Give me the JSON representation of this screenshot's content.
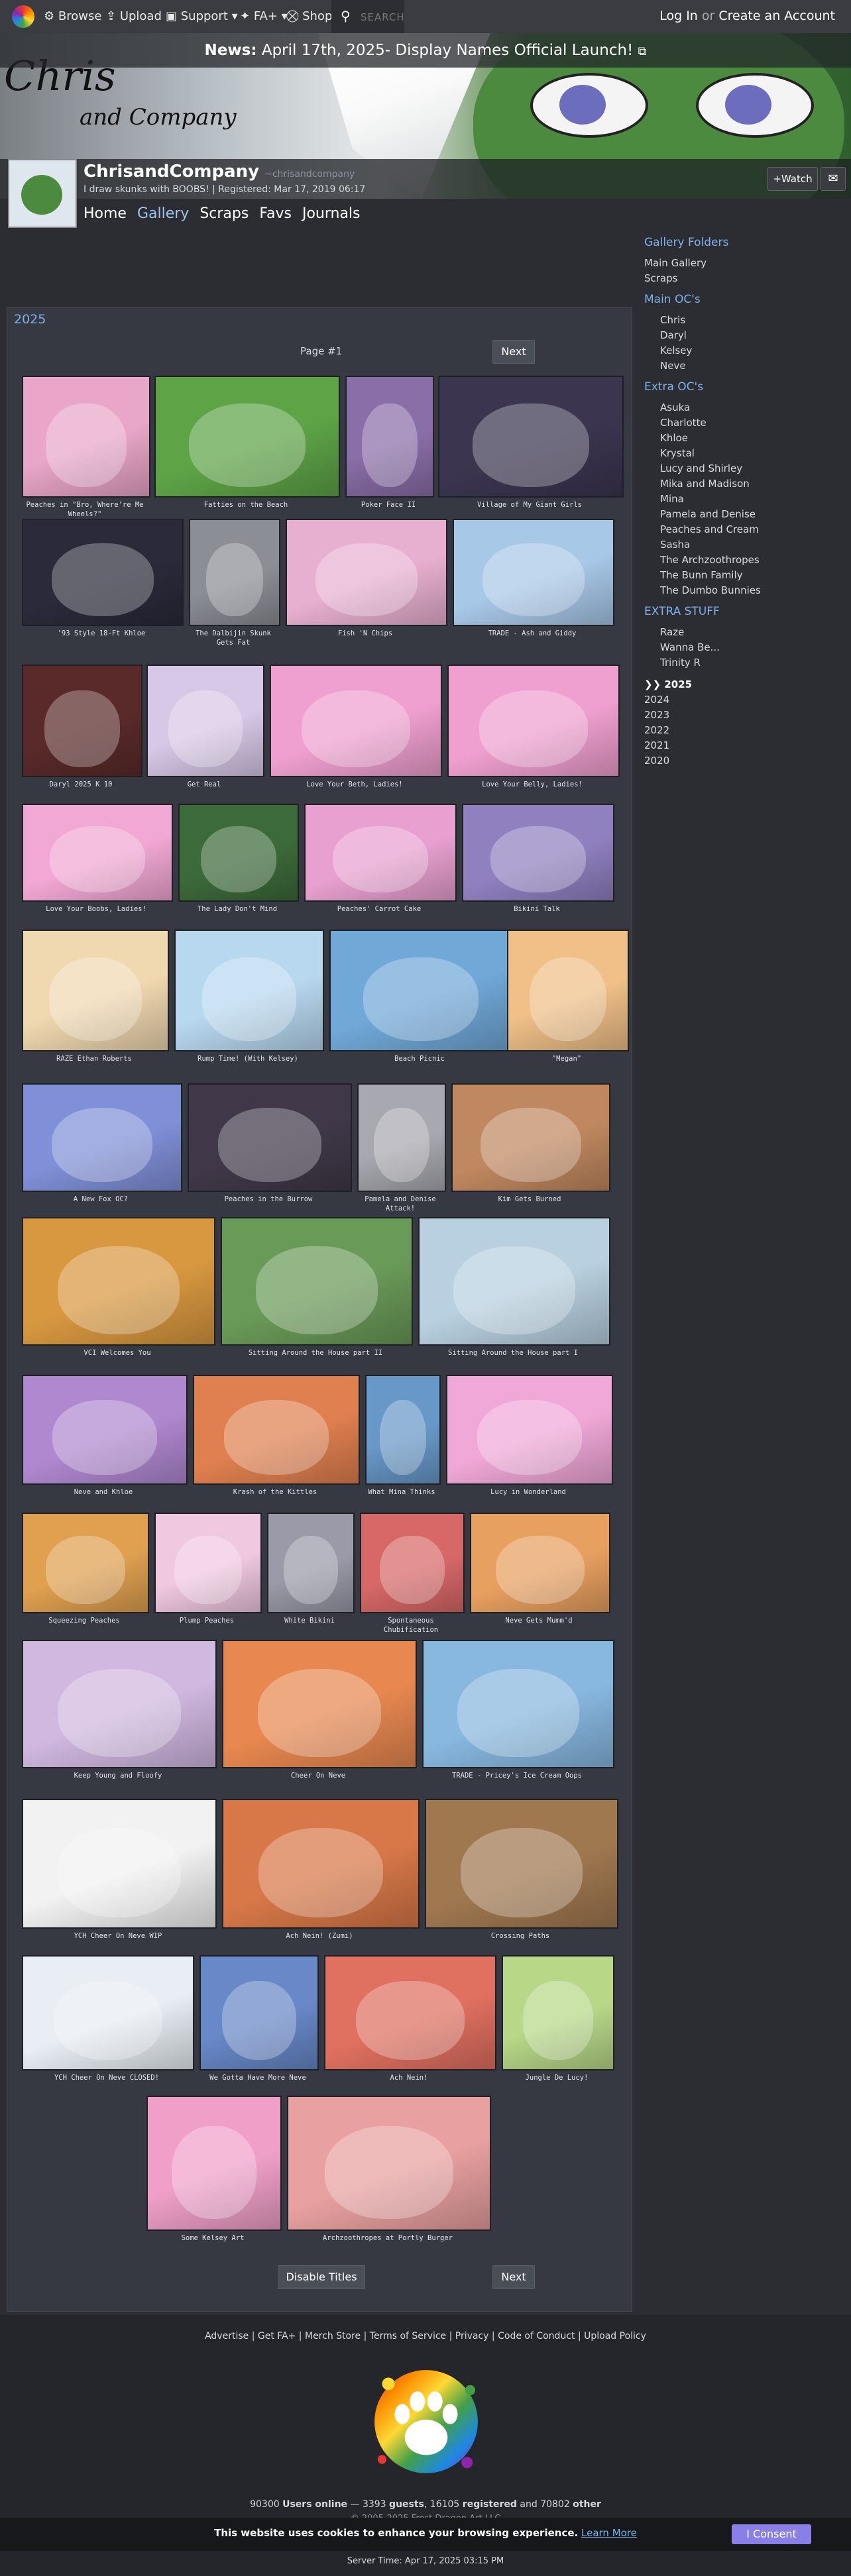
{
  "topnav": {
    "browse": "Browse",
    "upload": "Upload",
    "support": "Support",
    "fa_plus": "FA+",
    "shop": "Shop",
    "search_placeholder": "SEARCH",
    "login": "Log In",
    "or": "or",
    "create": "Create an Account"
  },
  "banner": {
    "brand_line1": "Chris",
    "brand_line2": "and Company",
    "news_label": "News:",
    "news_text": "April 17th, 2025- Display Names Official Launch!"
  },
  "user": {
    "display_name": "ChrisandCompany",
    "username": "~chrisandcompany",
    "tagline": "I draw skunks with BOOBS! | Registered: Mar 17, 2019 06:17",
    "watch": "+Watch"
  },
  "subnav": [
    "Home",
    "Gallery",
    "Scraps",
    "Favs",
    "Journals"
  ],
  "subnav_active": "Gallery",
  "sidebar": {
    "gallery_folders": "Gallery Folders",
    "main_items": [
      "Main Gallery",
      "Scraps"
    ],
    "main_ocs_title": "Main OC's",
    "main_ocs": [
      "Chris",
      "Daryl",
      "Kelsey",
      "Neve"
    ],
    "extra_ocs_title": "Extra OC's",
    "extra_ocs": [
      "Asuka",
      "Charlotte",
      "Khloe",
      "Krystal",
      "Lucy and Shirley",
      "Mika and Madison",
      "Mina",
      "Pamela and Denise",
      "Peaches and Cream",
      "Sasha",
      "The Archzoothropes",
      "The Bunn Family",
      "The Dumbo Bunnies"
    ],
    "extra_stuff_title": "EXTRA STUFF",
    "extra_stuff": [
      "Raze",
      "Wanna Be...",
      "Trinity R"
    ],
    "years": [
      "❯❯ 2025",
      "2024",
      "2023",
      "2022",
      "2021",
      "2020"
    ]
  },
  "gallery": {
    "title": "2025",
    "page_label": "Page #1",
    "next": "Next",
    "disable_titles": "Disable Titles",
    "rows": [
      {
        "items": [
          {
            "caption": "Peaches in \"Bro, Where're Me Wheels?\"",
            "color": "#e9a6c8"
          },
          {
            "caption": "Fatties on the Beach",
            "color": "#5ea447"
          },
          {
            "caption": "Poker Face II",
            "color": "#8a6ea8"
          },
          {
            "caption": "Village of My Giant Girls",
            "color": "#3b3550"
          }
        ]
      },
      {
        "items": [
          {
            "caption": "'93 Style 18-Ft Khloe",
            "color": "#2a2a3a"
          },
          {
            "caption": "The Dalbijin Skunk Gets Fat",
            "color": "#8c8e96"
          },
          {
            "caption": "Fish 'N Chips",
            "color": "#e8b0d0"
          },
          {
            "caption": "TRADE - Ash and Giddy",
            "color": "#a8c8e8"
          }
        ]
      },
      {
        "items": [
          {
            "caption": "Daryl 2025 K 10",
            "color": "#5a2a2a"
          },
          {
            "caption": "Get Real",
            "color": "#d8c8e8"
          },
          {
            "caption": "Love Your Beth, Ladies!",
            "color": "#f0a0d0"
          },
          {
            "caption": "Love Your Belly, Ladies!",
            "color": "#f0a0d0"
          }
        ]
      },
      {
        "items": [
          {
            "caption": "Love Your Boobs, Ladies!",
            "color": "#f2a8d4"
          },
          {
            "caption": "The Lady Don't Mind",
            "color": "#3c6a3a"
          },
          {
            "caption": "Peaches' Carrot Cake",
            "color": "#e8a0d0"
          },
          {
            "caption": "Bikini Talk",
            "color": "#9080c0"
          }
        ]
      },
      {
        "items": [
          {
            "caption": "RAZE Ethan Roberts",
            "color": "#f0d8b0"
          },
          {
            "caption": "Rump Time! (With Kelsey)",
            "color": "#b8d8f0"
          },
          {
            "caption": "Beach Picnic",
            "color": "#70a8d8"
          },
          {
            "caption": "\"Megan\"",
            "color": "#f0c088"
          }
        ]
      },
      {
        "items": [
          {
            "caption": "A New Fox OC?",
            "color": "#8090d8"
          },
          {
            "caption": "Peaches in the Burrow",
            "color": "#403848"
          },
          {
            "caption": "Pamela and Denise Attack!",
            "color": "#a8a8b0"
          },
          {
            "caption": "Kim Gets Burned",
            "color": "#c08860"
          }
        ]
      },
      {
        "items": [
          {
            "caption": "VCI Welcomes You",
            "color": "#d89840"
          },
          {
            "caption": "Sitting Around the House part II",
            "color": "#6a9a58"
          },
          {
            "caption": "Sitting Around the House part I",
            "color": "#b8d0e0"
          }
        ]
      },
      {
        "items": [
          {
            "caption": "Neve and Khloe",
            "color": "#b088d0"
          },
          {
            "caption": "Krash of the Kittles",
            "color": "#e08050"
          },
          {
            "caption": "What Mina Thinks",
            "color": "#6898c8"
          },
          {
            "caption": "Lucy in Wonderland",
            "color": "#f0a8d8"
          }
        ]
      },
      {
        "items": [
          {
            "caption": "Squeezing Peaches",
            "color": "#e0a050"
          },
          {
            "caption": "Plump Peaches",
            "color": "#f0c8e0"
          },
          {
            "caption": "White Bikini",
            "color": "#9a9aa8"
          },
          {
            "caption": "Spontaneous Chubification",
            "color": "#d86868"
          },
          {
            "caption": "Neve Gets Mumm'd",
            "color": "#e8a060"
          }
        ]
      },
      {
        "items": [
          {
            "caption": "Keep Young and Floofy",
            "color": "#d0b8e0"
          },
          {
            "caption": "Cheer On Neve",
            "color": "#e88850"
          },
          {
            "caption": "TRADE - Pricey's Ice Cream Oops",
            "color": "#88b8e0"
          }
        ]
      },
      {
        "items": [
          {
            "caption": "YCH Cheer On Neve WIP",
            "color": "#f2f2f2"
          },
          {
            "caption": "Ach Nein! (Zumi)",
            "color": "#d87848"
          },
          {
            "caption": "Crossing Paths",
            "color": "#a07850"
          }
        ]
      },
      {
        "items": [
          {
            "caption": "YCH Cheer On Neve CLOSED!",
            "color": "#e8eef4"
          },
          {
            "caption": "We Gotta Have More Neve",
            "color": "#6888c8"
          },
          {
            "caption": "Ach Nein!",
            "color": "#e07060"
          },
          {
            "caption": "Jungle De Lucy!",
            "color": "#b8d888"
          }
        ]
      },
      {
        "items": [
          {
            "caption": "Some Kelsey Art",
            "color": "#f0a0c8"
          },
          {
            "caption": "Archzoothropes at Portly Burger",
            "color": "#e8a0a0"
          }
        ]
      }
    ]
  },
  "footer": {
    "links": [
      "Advertise",
      "Get FA+",
      "Merch Store",
      "Terms of Service",
      "Privacy",
      "Code of Conduct",
      "Upload Policy"
    ],
    "online_count": "90300",
    "online_label": "Users online",
    "guests_count": "3393",
    "guests_label": "guests",
    "registered_count": "16105",
    "registered_label": "registered",
    "other_count": "70802",
    "other_label": "other",
    "copyright": "© 2005-2025 Frost Dragon Art LLC",
    "server_time": "Server Time: Apr 17, 2025 03:15 PM"
  },
  "cookie": {
    "text": "This website uses cookies to enhance your browsing experience.",
    "learn_more": "Learn More",
    "consent": "I Consent"
  }
}
